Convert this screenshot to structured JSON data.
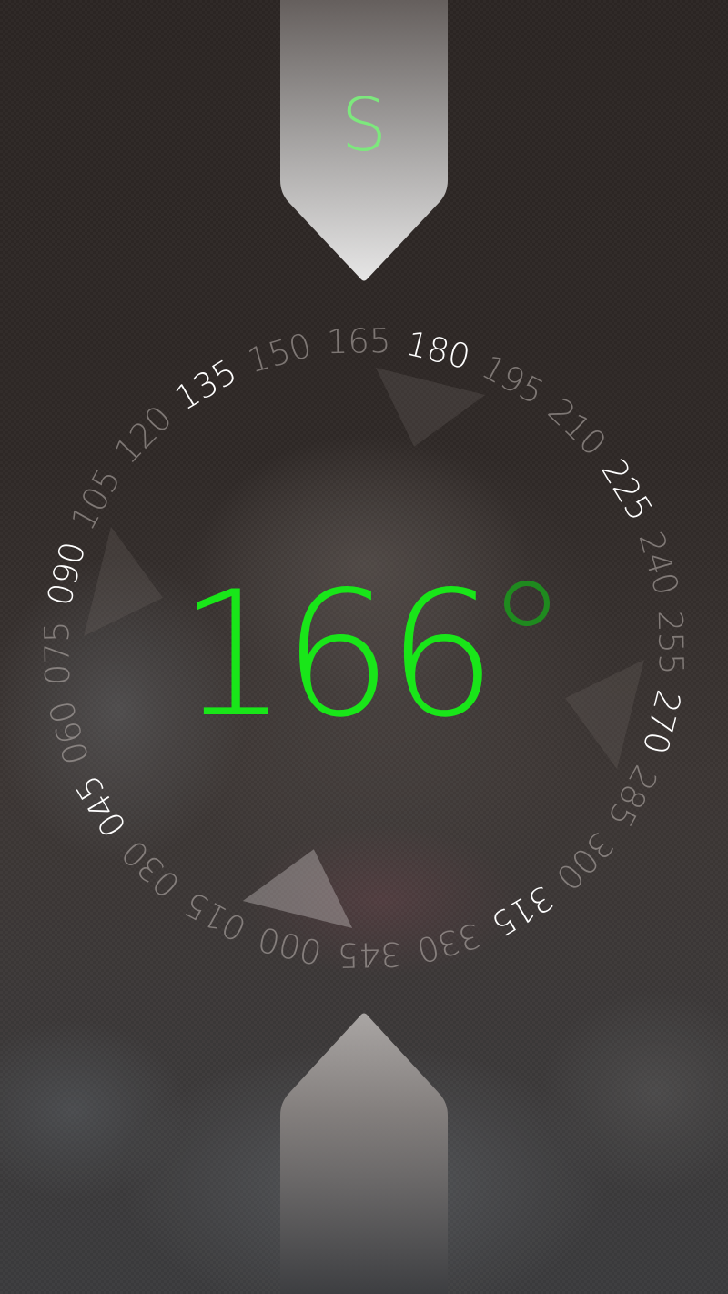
{
  "heading": {
    "degrees": "166",
    "cardinal": "S"
  },
  "dial": {
    "labels": [
      "000",
      "015",
      "030",
      "045",
      "060",
      "075",
      "090",
      "105",
      "120",
      "135",
      "150",
      "165",
      "180",
      "195",
      "210",
      "225",
      "240",
      "255",
      "270",
      "285",
      "300",
      "315",
      "330",
      "345"
    ],
    "major_labels": [
      "045",
      "090",
      "135",
      "180",
      "225",
      "270",
      "315"
    ]
  },
  "colors": {
    "accent_green": "#19e619",
    "cardinal_green": "#7de87d",
    "degree_ring_green": "#1f8a1f",
    "major_label": "#ffffff",
    "minor_label": "#bdb6b3"
  }
}
